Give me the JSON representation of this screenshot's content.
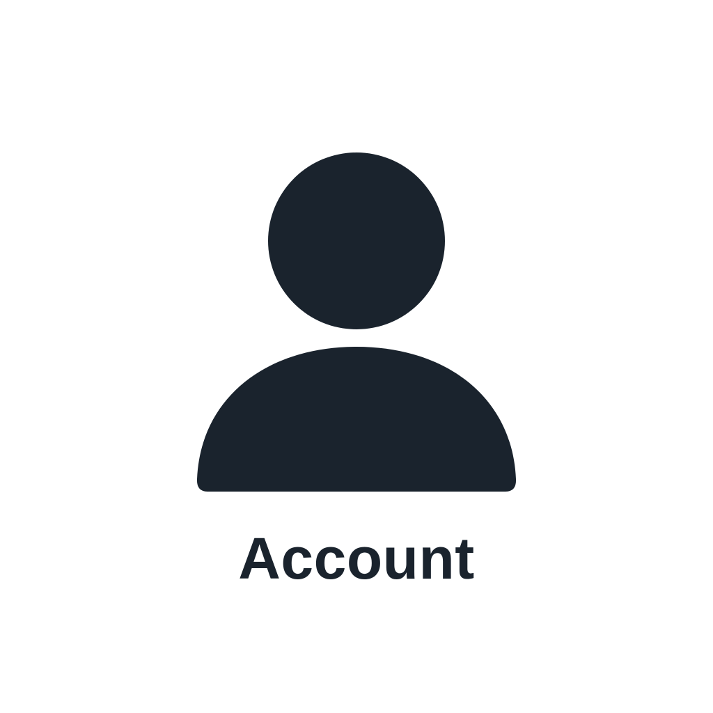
{
  "account": {
    "label": "Account",
    "icon": "person-icon"
  },
  "colors": {
    "background": "#ffffff",
    "icon": "#1a232d",
    "text": "#1a232d"
  }
}
